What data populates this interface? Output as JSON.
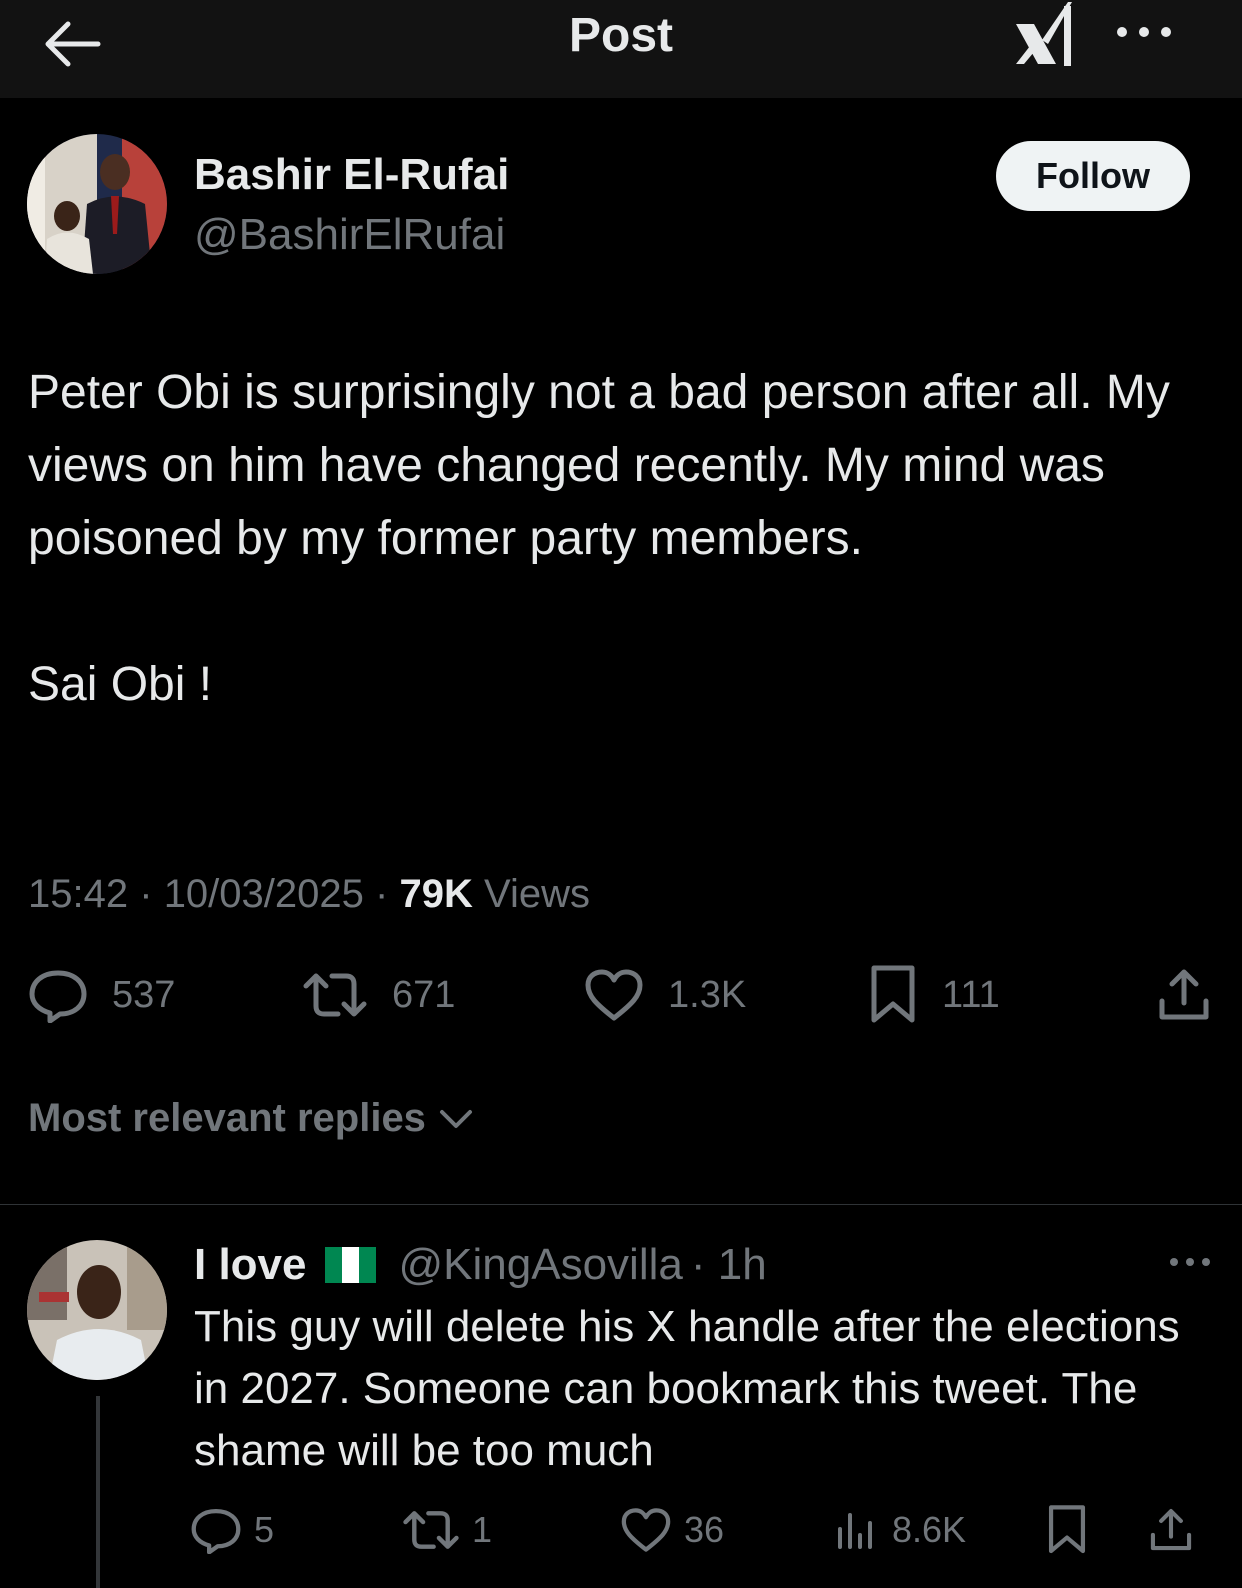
{
  "header": {
    "title": "Post",
    "back_icon": "arrow-left-icon",
    "grok_icon": "grok-icon",
    "more_icon": "more-horizontal-icon"
  },
  "post": {
    "author_name": "Bashir El-Rufai",
    "author_handle": "@BashirElRufai",
    "follow_label": "Follow",
    "text_lines": [
      "Peter Obi is surprisingly not a bad person after all. My views on him have changed recently. My mind was poisoned by my former party members.",
      "Sai Obi !"
    ],
    "time": "15:42",
    "date": "10/03/2025",
    "views_count": "79K",
    "views_label": "Views",
    "separator": "·",
    "replies": "537",
    "reposts": "671",
    "likes": "1.3K",
    "bookmarks": "111"
  },
  "replies_sort": {
    "label": "Most relevant replies",
    "icon": "chevron-down-icon"
  },
  "reply": {
    "name": "I love",
    "flag": "nigeria-flag",
    "handle": "@KingAsovilla",
    "time": "· 1h",
    "text": "This guy will delete his X handle after the elections in 2027. Someone can bookmark this tweet. The shame  will be too much",
    "replies": "5",
    "reposts": "1",
    "likes": "36",
    "views": "8.6K"
  },
  "colors": {
    "background": "#000000",
    "header_bg": "#121212",
    "text": "#e7e9ea",
    "secondary_text": "#71767b",
    "follow_bg": "#eff3f4",
    "divider": "#2f3336",
    "flag_green": "#008751"
  }
}
